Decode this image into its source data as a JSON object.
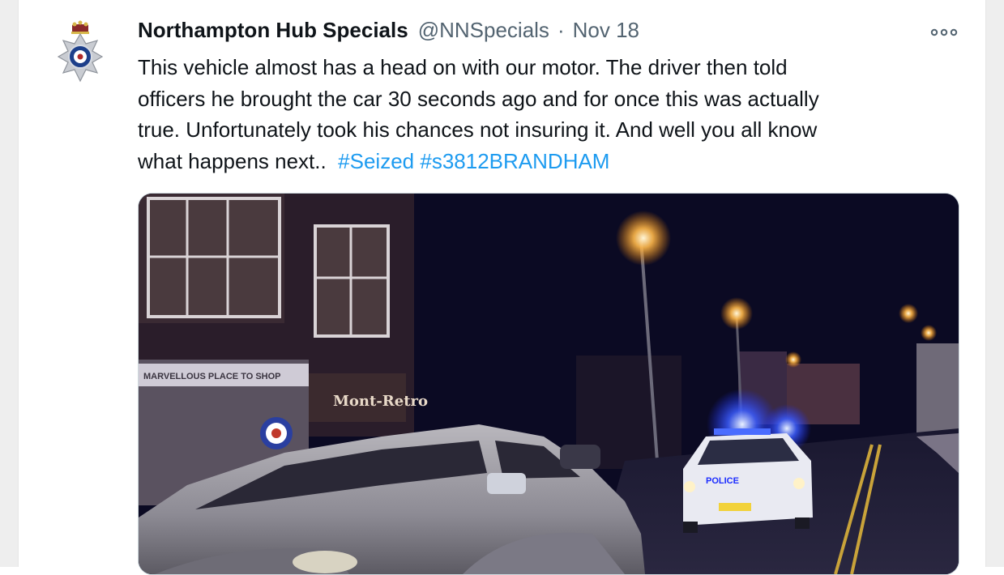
{
  "tweet": {
    "display_name": "Northampton Hub Specials",
    "handle": "@NNSpecials",
    "separator": "·",
    "date": "Nov 18",
    "text_line1": "This vehicle almost has a head on with our motor. The driver then told",
    "text_line2": "officers he brought the car 30 seconds ago and for once this was actually",
    "text_line3": "true. Unfortunately took his chances not insuring it. And well you all know",
    "text_line4": "what happens next..",
    "hashtags": [
      "#Seized",
      "#s3812BRANDHAM"
    ],
    "more_icon": "more-horizontal-icon",
    "avatar_icon": "police-badge-icon"
  },
  "photo": {
    "shop_sign": "MARVELLOUS PLACE TO SHOP",
    "retro_sign": "Mont-Retro",
    "police_text": "POLICE"
  },
  "colors": {
    "link": "#1d9bf0",
    "text": "#0f1419",
    "muted": "#536471",
    "night_sky": "#0b0a23",
    "siren_blue": "#3b5cff"
  }
}
